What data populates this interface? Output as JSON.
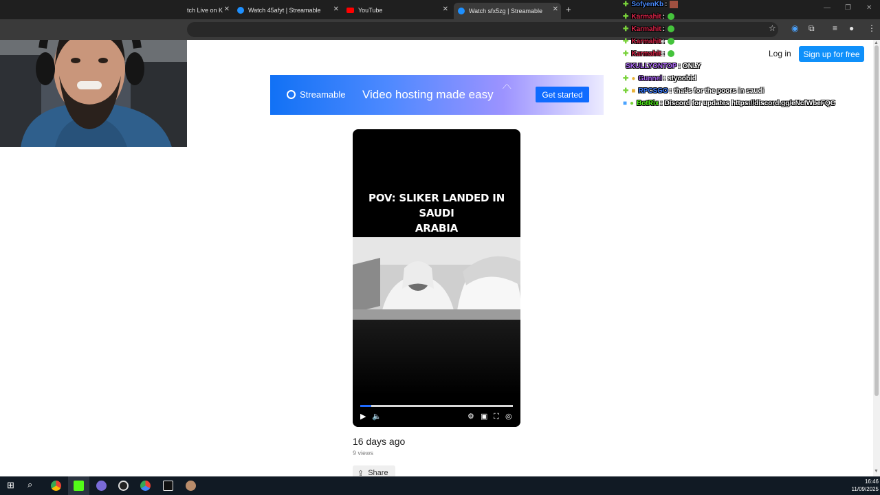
{
  "browser": {
    "tabs": [
      {
        "label": "tch Live on K",
        "icon": "kick-favicon"
      },
      {
        "label": "Watch 45afyt | Streamable",
        "icon": "streamable-favicon"
      },
      {
        "label": "YouTube",
        "icon": "youtube-favicon"
      },
      {
        "label": "Watch sfx5zg | Streamable",
        "icon": "streamable-favicon",
        "active": true
      }
    ],
    "new_tab_symbol": "+"
  },
  "header": {
    "login_label": "Log in",
    "signup_label": "Sign up for free"
  },
  "banner": {
    "brand": "Streamable",
    "tagline": "Video hosting made easy",
    "cta_label": "Get started",
    "colors": {
      "start": "#1171f5",
      "end": "#ecebff"
    }
  },
  "video": {
    "caption_line1": "POV: SLIKER LANDED IN SAUDI",
    "caption_line2": "ARABIA",
    "progress": 0.07,
    "accent": "#1f6bff"
  },
  "meta": {
    "date": "16 days ago",
    "views": "9 views",
    "share_label": "Share"
  },
  "chat": {
    "messages": [
      {
        "user": "SofyenKb",
        "sep": ":",
        "text": "",
        "user_color": "#4a8cff",
        "emote": "streamer-emote"
      },
      {
        "user": "Karmahit",
        "sep": ":",
        "text": "",
        "user_color": "#e0264b",
        "emote": "green-emote"
      },
      {
        "user": "Karmahit",
        "sep": ":",
        "text": "",
        "user_color": "#e0264b",
        "emote": "green-emote"
      },
      {
        "user": "Karmahit",
        "sep": ":",
        "text": "",
        "user_color": "#e0264b",
        "emote": "green-emote"
      },
      {
        "user": "Karmahit",
        "sep": ":",
        "text": "",
        "user_color": "#e0264b",
        "emote": "green-emote"
      },
      {
        "user": "SKULLYONTOP",
        "sep": ":",
        "text": "ONLY",
        "user_color": "#b36cff"
      },
      {
        "user": "Gunnel",
        "sep": ":",
        "text": "styoobid",
        "user_color": "#b36cff"
      },
      {
        "user": "RPCSGO",
        "sep": ":",
        "text": "that's for the poors in saudi",
        "user_color": "#3a7cff"
      },
      {
        "user": "BotRix",
        "sep": ":",
        "text": "Discord for updates https://discord.gg/eNcfWbeFQC",
        "user_color": "#53fc18"
      }
    ]
  },
  "taskbar": {
    "time": "16:46",
    "date": "11/09/2025"
  }
}
